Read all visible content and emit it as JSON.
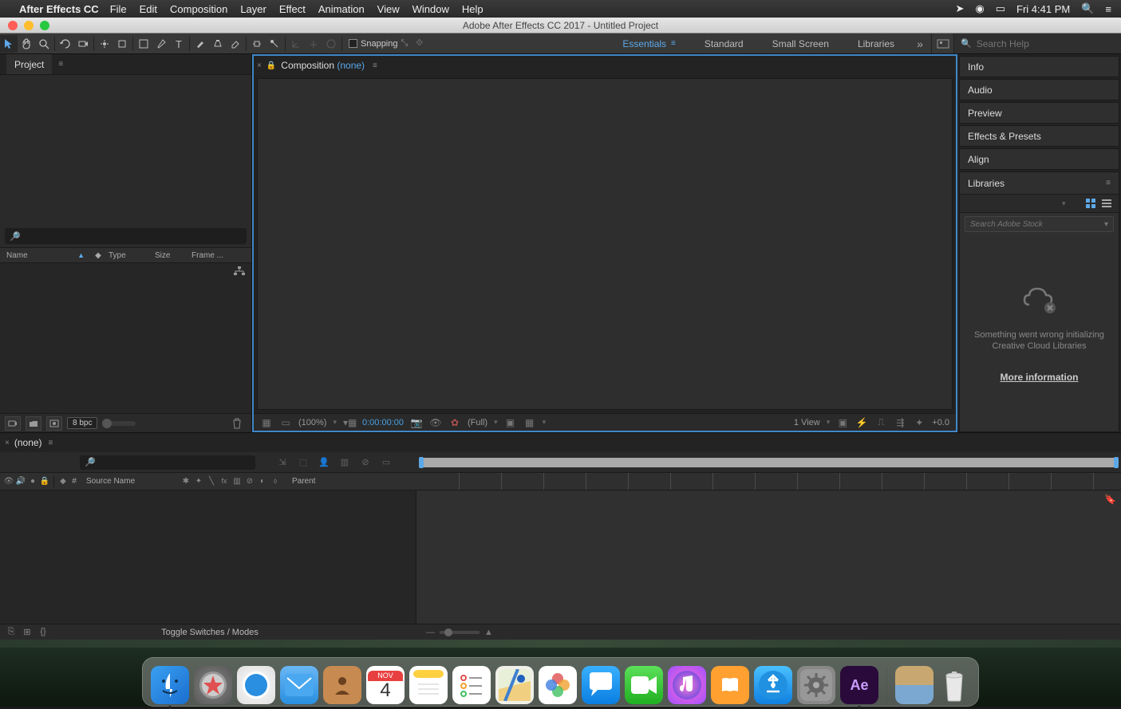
{
  "menubar": {
    "app_name": "After Effects CC",
    "items": [
      "File",
      "Edit",
      "Composition",
      "Layer",
      "Effect",
      "Animation",
      "View",
      "Window",
      "Help"
    ],
    "clock": "Fri 4:41 PM"
  },
  "titlebar": {
    "title": "Adobe After Effects CC 2017 - Untitled Project"
  },
  "toolbar": {
    "snapping_label": "Snapping",
    "workspaces": [
      "Essentials",
      "Standard",
      "Small Screen",
      "Libraries"
    ],
    "active_workspace": "Essentials",
    "search_placeholder": "Search Help"
  },
  "project_panel": {
    "tab": "Project",
    "columns": {
      "name": "Name",
      "type": "Type",
      "size": "Size",
      "frame": "Frame ..."
    },
    "bpc": "8 bpc"
  },
  "comp_panel": {
    "tab_label": "Composition",
    "tab_none": "(none)",
    "footer": {
      "mag": "(100%)",
      "time": "0:00:00:00",
      "res": "(Full)",
      "view": "1 View",
      "exposure": "+0.0"
    }
  },
  "right_panels": {
    "info": "Info",
    "audio": "Audio",
    "preview": "Preview",
    "effects": "Effects & Presets",
    "align": "Align",
    "libraries": {
      "label": "Libraries",
      "search_placeholder": "Search Adobe Stock",
      "error_line1": "Something went wrong initializing",
      "error_line2": "Creative Cloud Libraries",
      "more_info": "More information"
    }
  },
  "timeline": {
    "tab": "(none)",
    "columns": {
      "num": "#",
      "source": "Source Name",
      "parent": "Parent"
    },
    "footer_toggle": "Toggle Switches / Modes"
  },
  "dock": {
    "cal_month": "NOV",
    "cal_day": "4",
    "ae_label": "Ae"
  }
}
